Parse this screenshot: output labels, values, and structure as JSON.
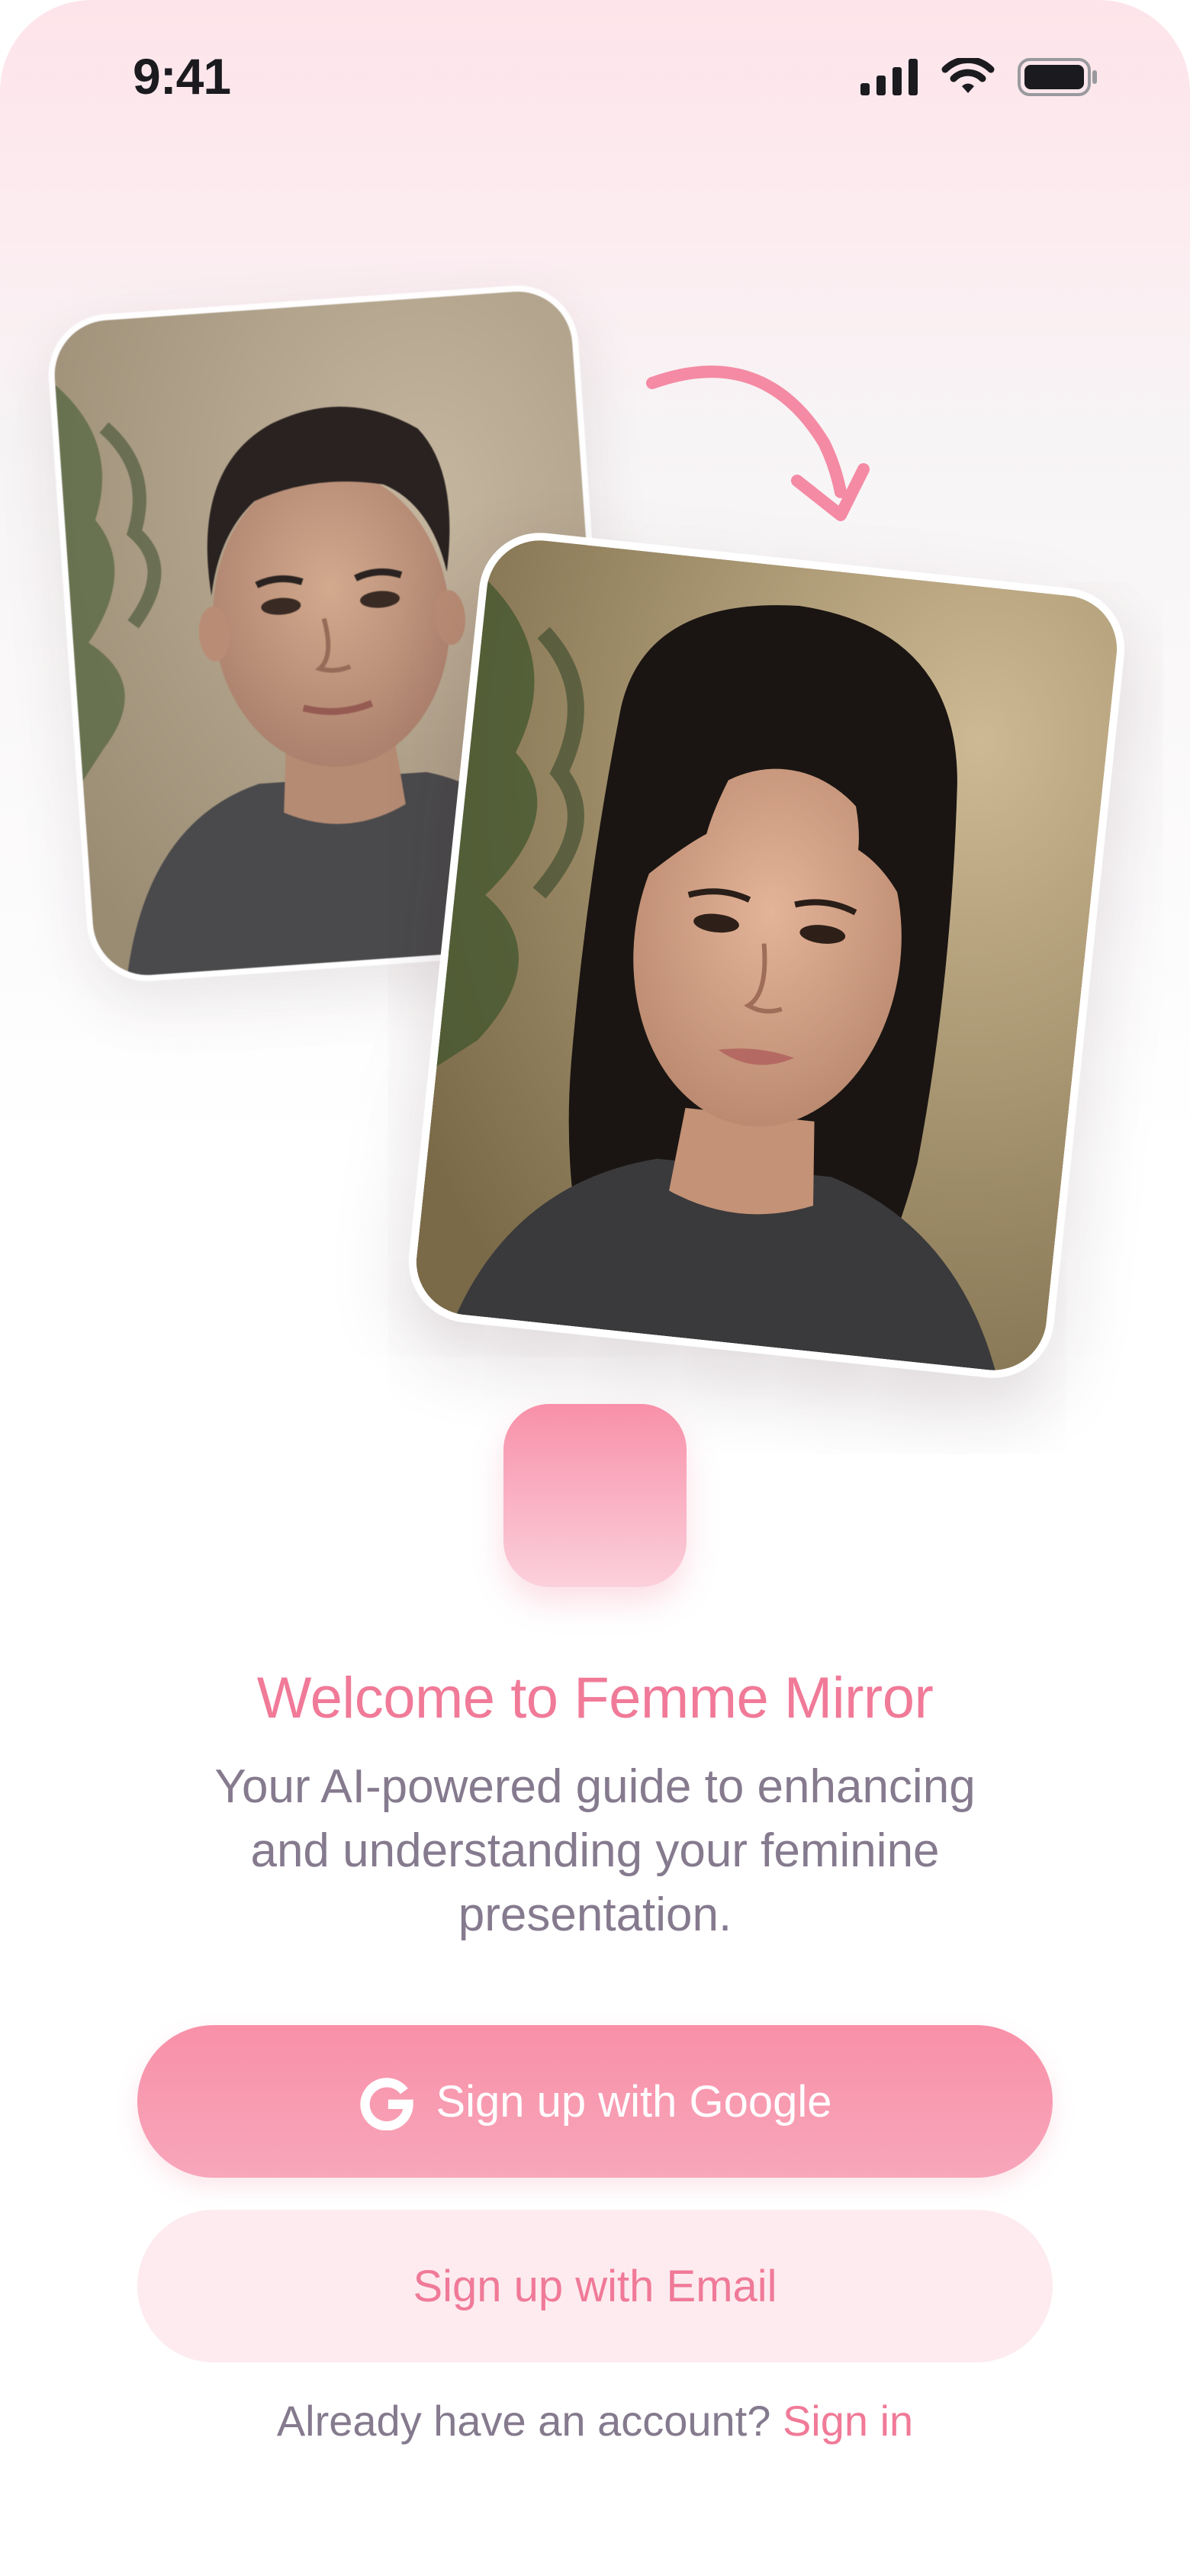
{
  "status_bar": {
    "time": "9:41",
    "icons": [
      "cellular-signal-icon",
      "wifi-icon",
      "battery-icon"
    ]
  },
  "illustration": {
    "before_photo": "portrait-photo-young-man",
    "after_photo": "portrait-photo-young-woman",
    "arrow": "curved-arrow-icon"
  },
  "welcome": {
    "title": "Welcome to Femme Mirror",
    "subtitle": "Your AI-powered guide to enhancing and understanding your feminine presentation."
  },
  "actions": {
    "google_label": "Sign up with Google",
    "email_label": "Sign up with Email"
  },
  "footer": {
    "prompt": "Already have an account?",
    "signin_label": "Sign in"
  },
  "colors": {
    "accent": "#f07a98",
    "button_primary": "#f890a8",
    "button_secondary_bg": "#fdebef",
    "text_muted": "#857a8e"
  }
}
